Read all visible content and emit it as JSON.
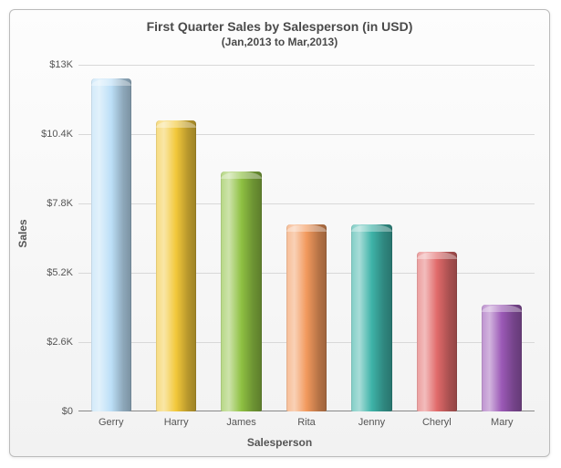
{
  "chart_data": {
    "type": "bar",
    "title": "First Quarter Sales by Salesperson (in USD)",
    "subtitle": "(Jan,2013 to Mar,2013)",
    "xlabel": "Salesperson",
    "ylabel": "Sales",
    "ylim": [
      0,
      13000
    ],
    "y_ticks": [
      {
        "v": 0,
        "label": "$0"
      },
      {
        "v": 2600,
        "label": "$2.6K"
      },
      {
        "v": 5200,
        "label": "$5.2K"
      },
      {
        "v": 7800,
        "label": "$7.8K"
      },
      {
        "v": 10400,
        "label": "$10.4K"
      },
      {
        "v": 13000,
        "label": "$13K"
      }
    ],
    "categories": [
      "Gerry",
      "Harry",
      "James",
      "Rita",
      "Jenny",
      "Cheryl",
      "Mary"
    ],
    "values": [
      12500,
      10900,
      9000,
      7000,
      7000,
      6000,
      4000
    ],
    "colors": [
      "#bcdff7",
      "#f2c83a",
      "#8fc143",
      "#f2995d",
      "#3eb3a8",
      "#e16a6a",
      "#9b59b6"
    ]
  }
}
